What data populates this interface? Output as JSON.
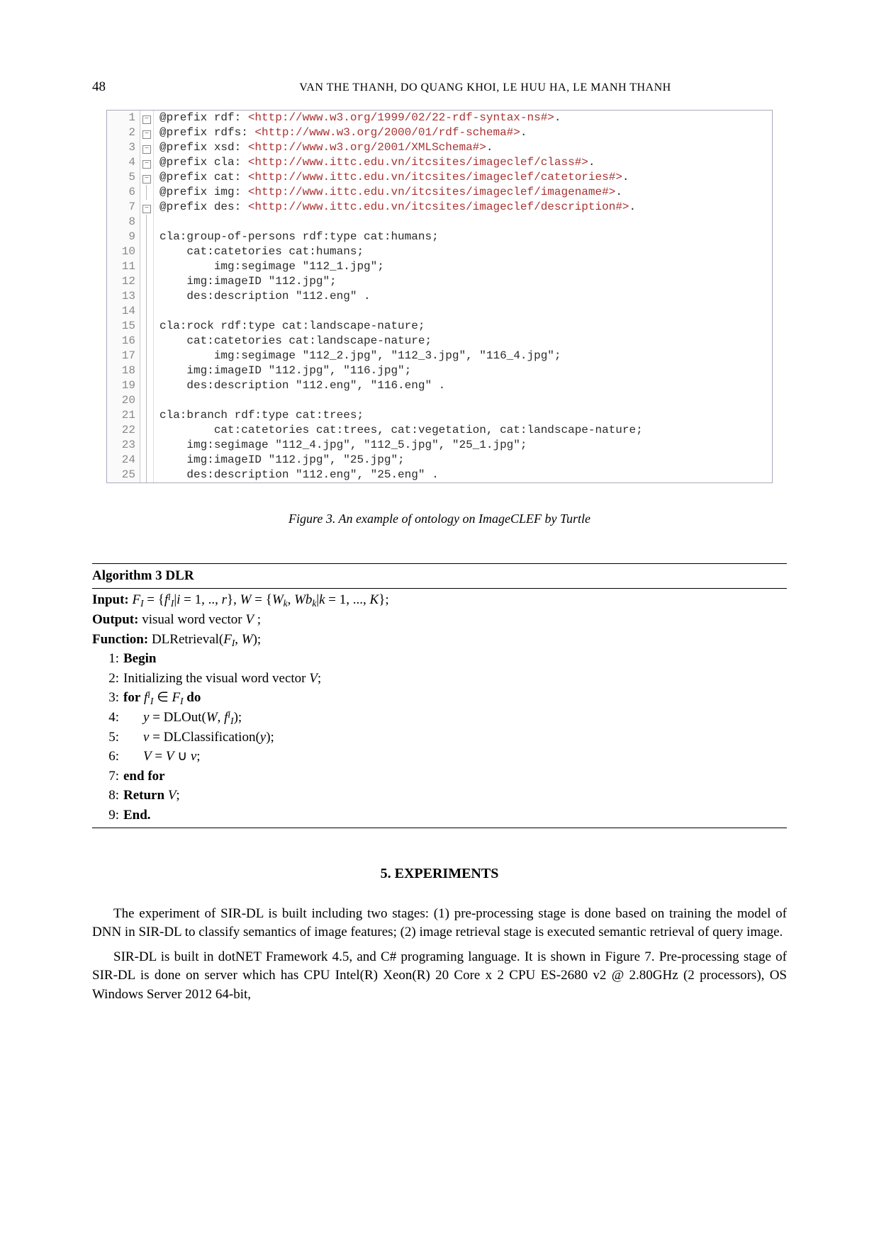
{
  "pageNumber": "48",
  "headerAuthors": "VAN THE THANH, DO QUANG KHOI, LE HUU HA, LE MANH THANH",
  "code": {
    "lines": [
      {
        "n": "1",
        "fold": "box",
        "pfx": "@prefix rdf: ",
        "url": "<http://www.w3.org/1999/02/22-rdf-syntax-ns#>",
        "tail": "."
      },
      {
        "n": "2",
        "fold": "box",
        "pfx": "@prefix rdfs: ",
        "url": "<http://www.w3.org/2000/01/rdf-schema#>",
        "tail": "."
      },
      {
        "n": "3",
        "fold": "box",
        "pfx": "@prefix xsd: ",
        "url": "<http://www.w3.org/2001/XMLSchema#>",
        "tail": "."
      },
      {
        "n": "4",
        "fold": "box",
        "pfx": "@prefix cla: ",
        "url": "<http://www.ittc.edu.vn/itcsites/imageclef/class#>",
        "tail": "."
      },
      {
        "n": "5",
        "fold": "box",
        "pfx": "@prefix cat: ",
        "url": "<http://www.ittc.edu.vn/itcsites/imageclef/catetories#>",
        "tail": "."
      },
      {
        "n": "6",
        "fold": "line",
        "pfx": "@prefix img: ",
        "url": "<http://www.ittc.edu.vn/itcsites/imageclef/imagename#>",
        "tail": "."
      },
      {
        "n": "7",
        "fold": "box",
        "pfx": "@prefix des: ",
        "url": "<http://www.ittc.edu.vn/itcsites/imageclef/description#>",
        "tail": "."
      },
      {
        "n": "8",
        "fold": "line",
        "pfx": "",
        "url": "",
        "tail": ""
      },
      {
        "n": "9",
        "fold": "line",
        "pfx": "cla:group-of-persons rdf:type cat:humans;",
        "url": "",
        "tail": ""
      },
      {
        "n": "10",
        "fold": "line",
        "pfx": "    cat:catetories cat:humans;",
        "url": "",
        "tail": ""
      },
      {
        "n": "11",
        "fold": "line",
        "pfx": "        img:segimage \"112_1.jpg\";",
        "url": "",
        "tail": ""
      },
      {
        "n": "12",
        "fold": "line",
        "pfx": "    img:imageID \"112.jpg\";",
        "url": "",
        "tail": ""
      },
      {
        "n": "13",
        "fold": "line",
        "pfx": "    des:description \"112.eng\" .",
        "url": "",
        "tail": ""
      },
      {
        "n": "14",
        "fold": "line",
        "pfx": "",
        "url": "",
        "tail": ""
      },
      {
        "n": "15",
        "fold": "line",
        "pfx": "cla:rock rdf:type cat:landscape-nature;",
        "url": "",
        "tail": ""
      },
      {
        "n": "16",
        "fold": "line",
        "pfx": "    cat:catetories cat:landscape-nature;",
        "url": "",
        "tail": ""
      },
      {
        "n": "17",
        "fold": "line",
        "pfx": "        img:segimage \"112_2.jpg\", \"112_3.jpg\", \"116_4.jpg\";",
        "url": "",
        "tail": ""
      },
      {
        "n": "18",
        "fold": "line",
        "pfx": "    img:imageID \"112.jpg\", \"116.jpg\";",
        "url": "",
        "tail": ""
      },
      {
        "n": "19",
        "fold": "line",
        "pfx": "    des:description \"112.eng\", \"116.eng\" .",
        "url": "",
        "tail": ""
      },
      {
        "n": "20",
        "fold": "line",
        "pfx": "",
        "url": "",
        "tail": ""
      },
      {
        "n": "21",
        "fold": "line",
        "pfx": "cla:branch rdf:type cat:trees;",
        "url": "",
        "tail": ""
      },
      {
        "n": "22",
        "fold": "line",
        "pfx": "        cat:catetories cat:trees, cat:vegetation, cat:landscape-nature;",
        "url": "",
        "tail": ""
      },
      {
        "n": "23",
        "fold": "line",
        "pfx": "    img:segimage \"112_4.jpg\", \"112_5.jpg\", \"25_1.jpg\";",
        "url": "",
        "tail": ""
      },
      {
        "n": "24",
        "fold": "line",
        "pfx": "    img:imageID \"112.jpg\", \"25.jpg\";",
        "url": "",
        "tail": ""
      },
      {
        "n": "25",
        "fold": "line",
        "pfx": "    des:description \"112.eng\", \"25.eng\" .",
        "url": "",
        "tail": ""
      }
    ]
  },
  "figureCaption": {
    "label": "Figure 3.",
    "text": " An example of ontology on ImageCLEF by Turtle"
  },
  "algorithm": {
    "title": "Algorithm 3 DLR",
    "input_label": "Input:",
    "input_body": "  Fᵢ = {fᵢⁱ | i = 1, .., r},  W = {Wₖ, Wbₖ | k = 1, ..., K};",
    "output_label": "Output:",
    "output_body": "  visual word vector V ;",
    "function_label": "Function:",
    "function_body": "  DLRetrieval(Fᵢ, W);",
    "steps": [
      {
        "n": "1:",
        "html": "<b class='kw'>Begin</b>"
      },
      {
        "n": "2:",
        "html": "Initializing the visual word vector <span class='math-i'>V</span>;"
      },
      {
        "n": "3:",
        "html": "<b class='kw'>for</b> <span class='math-i'>f</span><span class='sup math-i'>i</span><span class='sub math-i'>I</span> ∈ <span class='math-i'>F</span><span class='sub math-i'>I</span> <b class='kw'>do</b>"
      },
      {
        "n": "4:",
        "html": "<span class='indent1'><span class='math-i'>y</span> = DLOut(<span class='math-i'>W</span>, <span class='math-i'>f</span><span class='sup math-i'>i</span><span class='sub math-i'>I</span>);</span>"
      },
      {
        "n": "5:",
        "html": "<span class='indent1'><span class='math-i'>v</span> = DLClassification(<span class='math-i'>y</span>);</span>"
      },
      {
        "n": "6:",
        "html": "<span class='indent1'><span class='math-i'>V</span> = <span class='math-i'>V</span> ∪ <span class='math-i'>v</span>;</span>"
      },
      {
        "n": "7:",
        "html": "<b class='kw'>end for</b>"
      },
      {
        "n": "8:",
        "html": "<b class='kw'>Return</b> <span class='math-i'>V</span>;"
      },
      {
        "n": "9:",
        "html": "<b class='kw'>End.</b>"
      }
    ]
  },
  "sectionHeading": "5.    EXPERIMENTS",
  "paragraphs": [
    "The experiment of SIR-DL is built including two stages: (1) pre-processing stage is done based on training the model of DNN in SIR-DL to classify semantics of image features; (2) image retrieval stage is executed semantic retrieval of query image.",
    "SIR-DL is built in dotNET Framework 4.5, and C# programing language. It is shown in Figure 7. Pre-processing stage of SIR-DL is done on server which has CPU Intel(R) Xeon(R) 20 Core x 2 CPU ES-2680 v2 @ 2.80GHz (2 processors), OS Windows Server 2012 64-bit,"
  ]
}
